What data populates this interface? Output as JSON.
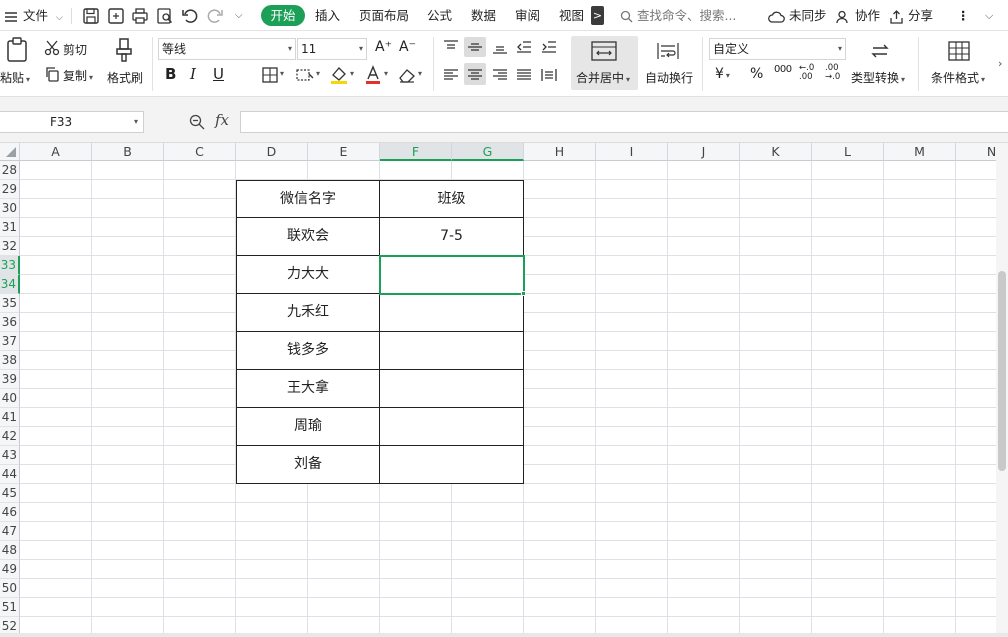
{
  "menubar": {
    "file_label": "文件",
    "tabs": [
      "开始",
      "插入",
      "页面布局",
      "公式",
      "数据",
      "审阅",
      "视图"
    ],
    "more_label": ">",
    "search_placeholder": "查找命令、搜索...",
    "sync_label": "未同步",
    "collab_label": "协作",
    "share_label": "分享",
    "overflow_label": "⋮"
  },
  "ribbon": {
    "paste_label": "粘贴",
    "cut_label": "剪切",
    "copy_label": "复制",
    "format_painter_label": "格式刷",
    "font_name": "等线",
    "font_size": "11",
    "grow_font": "A⁺",
    "shrink_font": "A⁻",
    "bold": "B",
    "italic": "I",
    "underline": "U",
    "merge_center_label": "合并居中",
    "wrap_text_label": "自动换行",
    "number_format": "自定义",
    "currency_symbol": "¥",
    "percent_symbol": "%",
    "thousands_symbol": "000",
    "inc_decimal": "←.0\n.00",
    "dec_decimal": ".00\n→.0",
    "convert_type_label": "类型转换",
    "cond_format_label": "条件格式"
  },
  "formula_bar": {
    "name_box": "F33",
    "fx_label": "fx",
    "formula": ""
  },
  "sheet": {
    "columns": [
      "A",
      "B",
      "C",
      "D",
      "E",
      "F",
      "G",
      "H",
      "I",
      "J",
      "K",
      "L",
      "M",
      "N"
    ],
    "rows": [
      "28",
      "29",
      "30",
      "31",
      "32",
      "33",
      "34",
      "35",
      "36",
      "37",
      "38",
      "39",
      "40",
      "41",
      "42",
      "43",
      "44",
      "45",
      "46",
      "47",
      "48",
      "49",
      "50",
      "51",
      "52"
    ],
    "selected_cell": "F33",
    "table": {
      "header": {
        "name": "微信名字",
        "class": "班级"
      },
      "rows": [
        {
          "name": "联欢会",
          "class": "7-5"
        },
        {
          "name": "力大大",
          "class": ""
        },
        {
          "name": "九禾红",
          "class": ""
        },
        {
          "name": "钱多多",
          "class": ""
        },
        {
          "name": "王大拿",
          "class": ""
        },
        {
          "name": "周瑜",
          "class": ""
        },
        {
          "name": "刘备",
          "class": ""
        }
      ]
    }
  },
  "colors": {
    "accent": "#1c9f57",
    "header_bg": "#f5f6f7",
    "grid": "#dde0e4"
  }
}
